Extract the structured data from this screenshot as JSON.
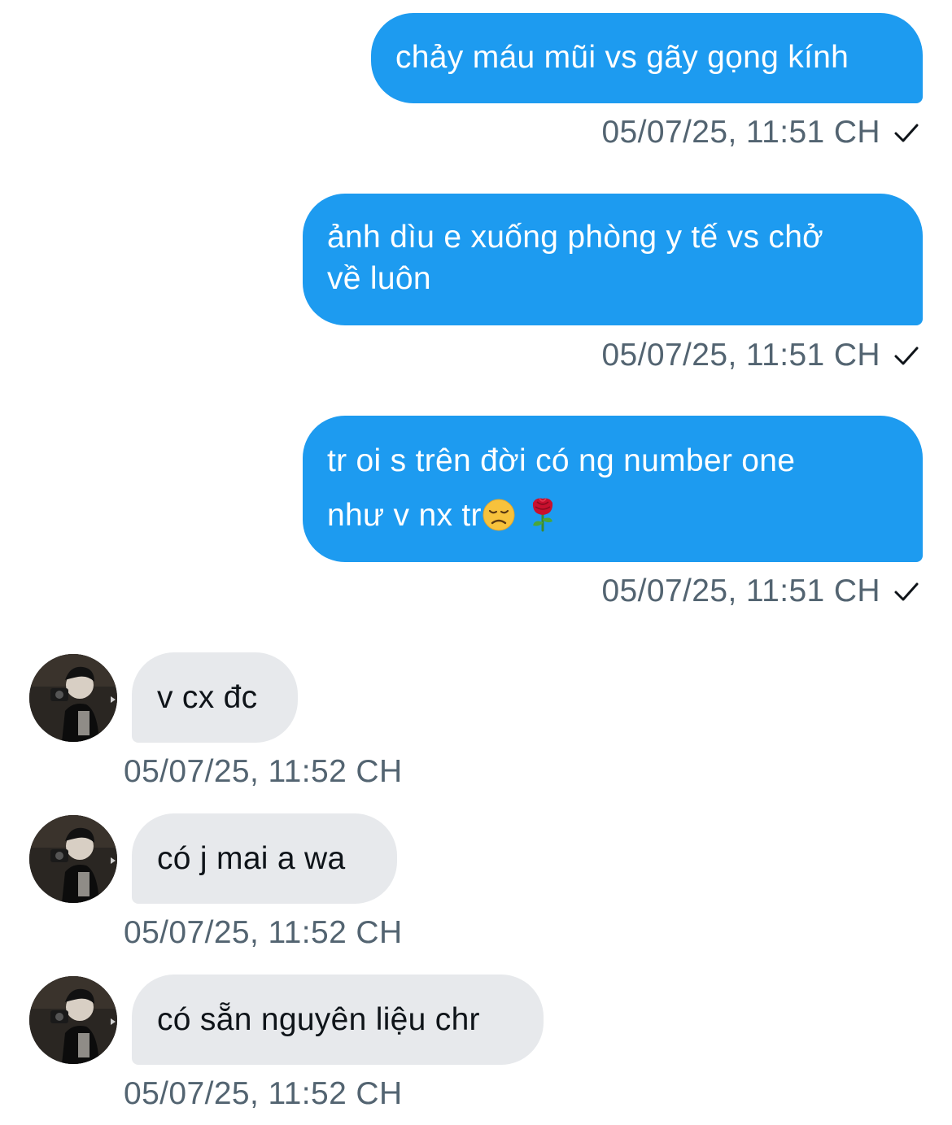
{
  "messages": [
    {
      "direction": "outgoing",
      "lines": [
        "chảy máu mũi vs gãy gọng kính"
      ],
      "timestamp": "05/07/25, 11:51 CH",
      "status_icon": "checkmark-icon"
    },
    {
      "direction": "outgoing",
      "lines": [
        "ảnh dìu e xuống phòng y tế vs chở",
        "về luôn"
      ],
      "timestamp": "05/07/25, 11:51 CH",
      "status_icon": "checkmark-icon"
    },
    {
      "direction": "outgoing",
      "lines": [
        "tr oi s trên đời có ng number one",
        "như v nx tr"
      ],
      "emojis": [
        "disappointed-face-emoji",
        "rose-emoji"
      ],
      "timestamp": "05/07/25, 11:51 CH",
      "status_icon": "checkmark-icon"
    },
    {
      "direction": "incoming",
      "lines": [
        "v cx đc"
      ],
      "timestamp": "05/07/25, 11:52 CH",
      "avatar_icon": "user-avatar"
    },
    {
      "direction": "incoming",
      "lines": [
        "có j mai a wa"
      ],
      "timestamp": "05/07/25, 11:52 CH",
      "avatar_icon": "user-avatar"
    },
    {
      "direction": "incoming",
      "lines": [
        "có sẵn nguyên liệu chr"
      ],
      "timestamp": "05/07/25, 11:52 CH",
      "avatar_icon": "user-avatar"
    }
  ],
  "colors": {
    "outgoing_bubble": "#1d9bf0",
    "incoming_bubble": "#e7e9ec",
    "timestamp_text": "#536471"
  }
}
